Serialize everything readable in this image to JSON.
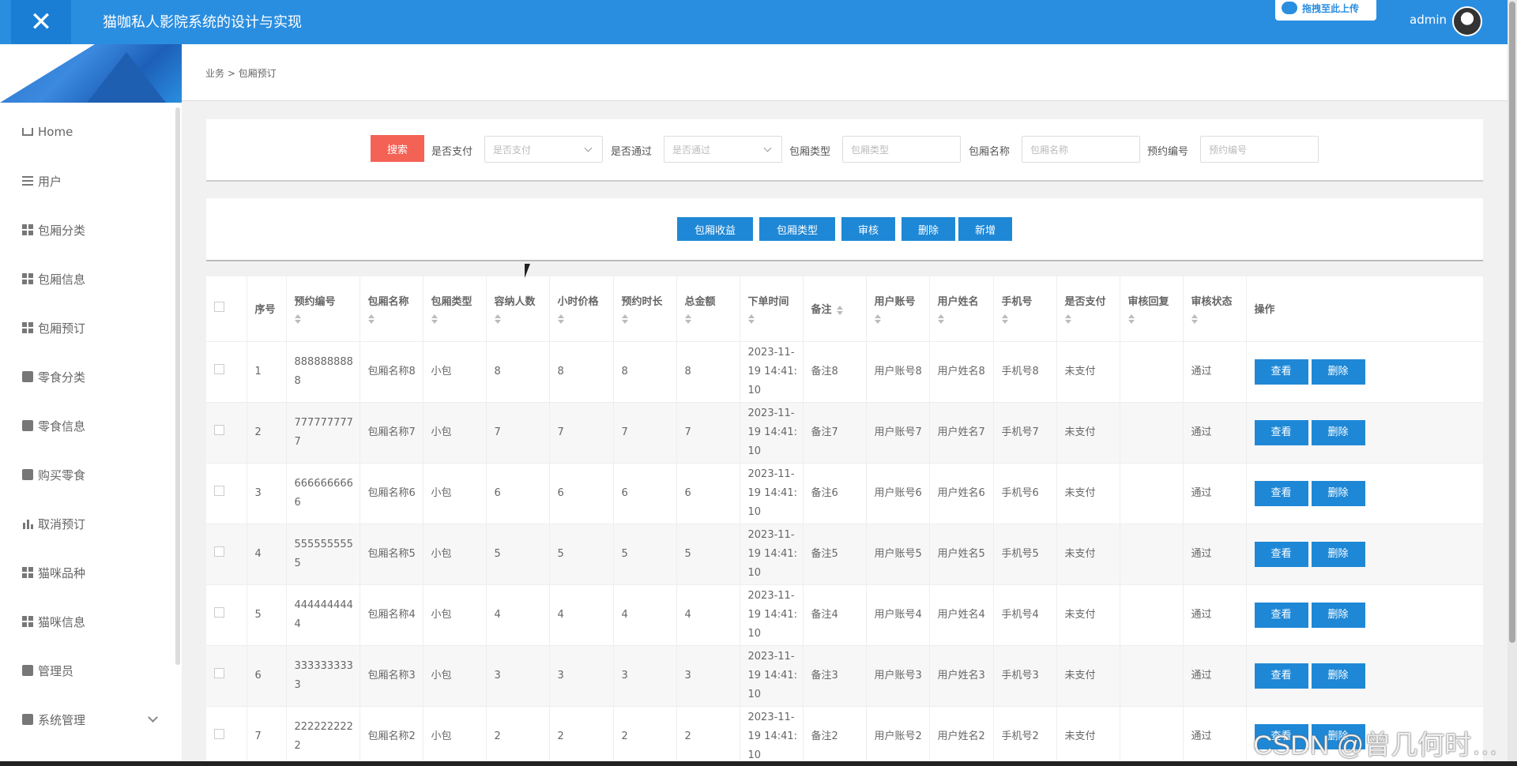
{
  "app": {
    "title": "猫咖私人影院系统的设计与实现",
    "upload_tag": "拖拽至此上传",
    "admin": "admin"
  },
  "sidebar": {
    "items": [
      {
        "label": "Home",
        "icon": "home-icon"
      },
      {
        "label": "用户",
        "icon": "list-icon"
      },
      {
        "label": "包厢分类",
        "icon": "grid-icon"
      },
      {
        "label": "包厢信息",
        "icon": "grid-icon"
      },
      {
        "label": "包厢预订",
        "icon": "grid-icon"
      },
      {
        "label": "零食分类",
        "icon": "book-icon"
      },
      {
        "label": "零食信息",
        "icon": "cup-icon"
      },
      {
        "label": "购买零食",
        "icon": "clipboard-icon"
      },
      {
        "label": "取消预订",
        "icon": "bar-chart-icon"
      },
      {
        "label": "猫咪品种",
        "icon": "grid-icon"
      },
      {
        "label": "猫咪信息",
        "icon": "grid-icon"
      },
      {
        "label": "管理员",
        "icon": "monitor-icon"
      },
      {
        "label": "系统管理",
        "icon": "check-square-icon"
      }
    ]
  },
  "breadcrumb": "业务 > 包厢预订",
  "search": {
    "button": "搜索",
    "fields": [
      {
        "label": "是否支付",
        "placeholder": "是否支付",
        "type": "select"
      },
      {
        "label": "是否通过",
        "placeholder": "是否通过",
        "type": "select"
      },
      {
        "label": "包厢类型",
        "placeholder": "包厢类型",
        "type": "input"
      },
      {
        "label": "包厢名称",
        "placeholder": "包厢名称",
        "type": "input"
      },
      {
        "label": "预约编号",
        "placeholder": "预约编号",
        "type": "input"
      }
    ]
  },
  "actions": [
    "包厢收益",
    "包厢类型",
    "审核",
    "删除",
    "新增"
  ],
  "table": {
    "columns": [
      "序号",
      "预约编号",
      "包厢名称",
      "包厢类型",
      "容纳人数",
      "小时价格",
      "预约时长",
      "总金额",
      "下单时间",
      "备注",
      "用户账号",
      "用户姓名",
      "手机号",
      "是否支付",
      "审核回复",
      "审核状态",
      "操作"
    ],
    "row_buttons": {
      "view": "查看",
      "delete": "删除"
    },
    "rows": [
      [
        "1",
        "8888888888",
        "包厢名称8",
        "小包",
        "8",
        "8",
        "8",
        "8",
        "2023-11-19 14:41:10",
        "备注8",
        "用户账号8",
        "用户姓名8",
        "手机号8",
        "未支付",
        "",
        "通过"
      ],
      [
        "2",
        "7777777777",
        "包厢名称7",
        "小包",
        "7",
        "7",
        "7",
        "7",
        "2023-11-19 14:41:10",
        "备注7",
        "用户账号7",
        "用户姓名7",
        "手机号7",
        "未支付",
        "",
        "通过"
      ],
      [
        "3",
        "6666666666",
        "包厢名称6",
        "小包",
        "6",
        "6",
        "6",
        "6",
        "2023-11-19 14:41:10",
        "备注6",
        "用户账号6",
        "用户姓名6",
        "手机号6",
        "未支付",
        "",
        "通过"
      ],
      [
        "4",
        "5555555555",
        "包厢名称5",
        "小包",
        "5",
        "5",
        "5",
        "5",
        "2023-11-19 14:41:10",
        "备注5",
        "用户账号5",
        "用户姓名5",
        "手机号5",
        "未支付",
        "",
        "通过"
      ],
      [
        "5",
        "4444444444",
        "包厢名称4",
        "小包",
        "4",
        "4",
        "4",
        "4",
        "2023-11-19 14:41:10",
        "备注4",
        "用户账号4",
        "用户姓名4",
        "手机号4",
        "未支付",
        "",
        "通过"
      ],
      [
        "6",
        "3333333333",
        "包厢名称3",
        "小包",
        "3",
        "3",
        "3",
        "3",
        "2023-11-19 14:41:10",
        "备注3",
        "用户账号3",
        "用户姓名3",
        "手机号3",
        "未支付",
        "",
        "通过"
      ],
      [
        "7",
        "2222222222",
        "包厢名称2",
        "小包",
        "2",
        "2",
        "2",
        "2",
        "2023-11-19 14:41:10",
        "备注2",
        "用户账号2",
        "用户姓名2",
        "手机号2",
        "未支付",
        "",
        "通过"
      ]
    ]
  },
  "watermark": "CSDN @曾几何时…",
  "colors": {
    "primary": "#2a8ee0",
    "button": "#1f88d6",
    "search": "#f46256"
  }
}
